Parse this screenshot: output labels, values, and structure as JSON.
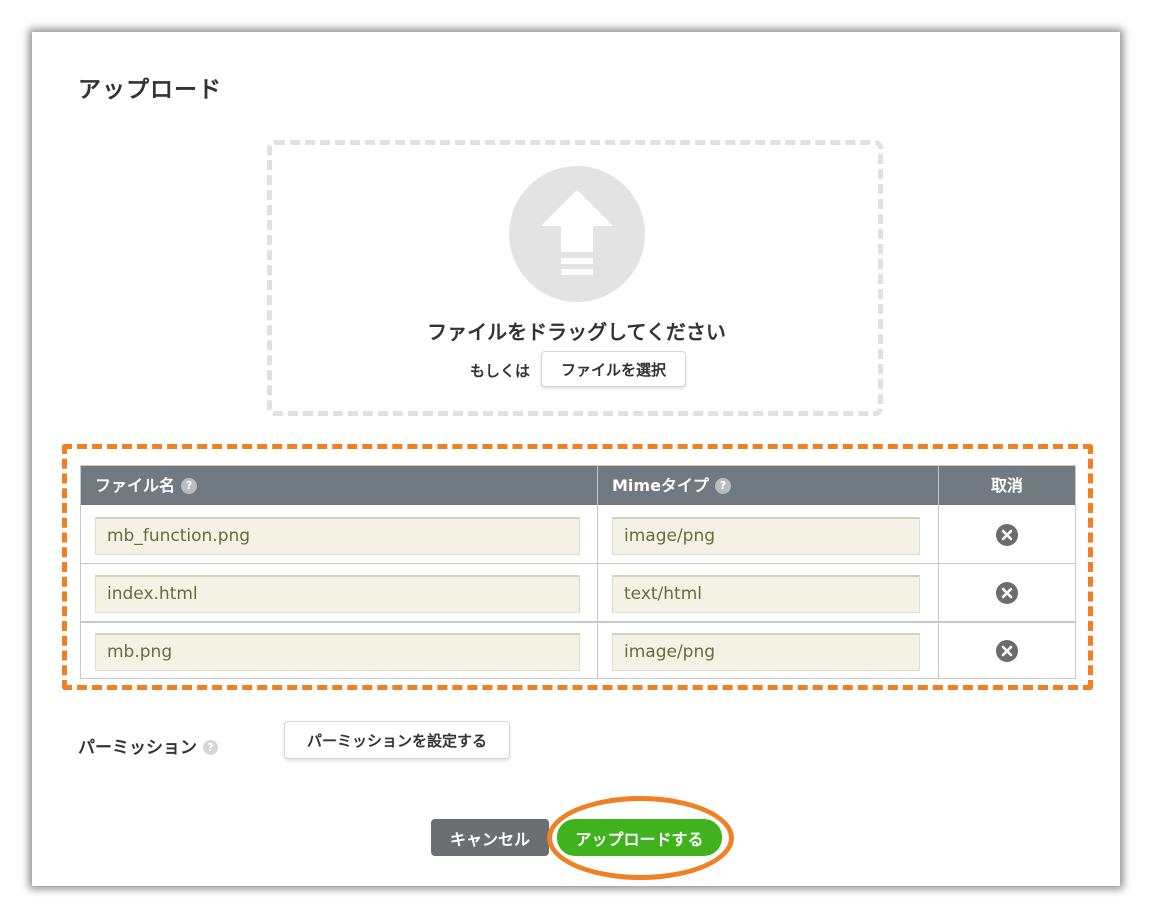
{
  "dialog": {
    "title": "アップロード"
  },
  "dropzone": {
    "icon": "upload-arrow-icon",
    "instruction": "ファイルをドラッグしてください",
    "or_text": "もしくは",
    "choose_button": "ファイルを選択"
  },
  "table": {
    "headers": {
      "file_name": "ファイル名",
      "mime_type": "Mimeタイプ",
      "cancel": "取消"
    },
    "help_glyph": "?",
    "rows": [
      {
        "file_name": "mb_function.png",
        "mime_type": "image/png"
      },
      {
        "file_name": "index.html",
        "mime_type": "text/html"
      },
      {
        "file_name": "mb.png",
        "mime_type": "image/png"
      }
    ]
  },
  "permission": {
    "label": "パーミッション",
    "button": "パーミッションを設定する"
  },
  "footer": {
    "cancel_button": "キャンセル",
    "upload_button": "アップロードする"
  },
  "colors": {
    "highlight": "#ef8023",
    "upload_green": "#40b21e",
    "header_gray": "#717a80",
    "field_bg": "#f4f2e4"
  }
}
